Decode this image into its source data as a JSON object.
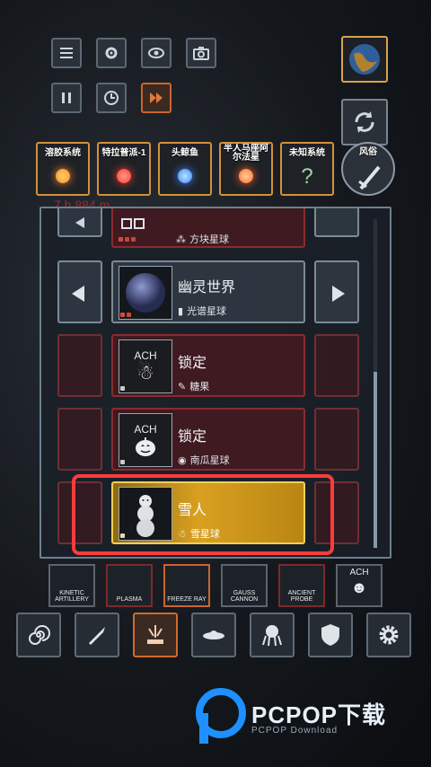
{
  "toolbar": {
    "menu_icon": "menu-icon",
    "settings_icon": "gear-icon",
    "view_icon": "eye-icon",
    "camera_icon": "camera-icon",
    "pause_icon": "pause-icon",
    "time_icon": "clock-icon",
    "fastforward_icon": "fast-forward-icon"
  },
  "background_stat": "7.h 884 m",
  "categories": [
    {
      "label": "溶胶系统",
      "color": "#ff8a2a"
    },
    {
      "label": "特拉普派-1",
      "color": "#ff4a3a"
    },
    {
      "label": "头鲸鱼",
      "color": "#3a8bff"
    },
    {
      "label": "半人马座阿尔法星",
      "color": "#ff6a2a"
    },
    {
      "label": "未知系统",
      "color": "#7ad07a"
    },
    {
      "label": "风俗",
      "color": "#cfd6dc"
    }
  ],
  "list": {
    "rows": [
      {
        "title": "",
        "subtitle": "方块星球",
        "state": "red"
      },
      {
        "title": "幽灵世界",
        "subtitle": "光谱星球",
        "state": "grey"
      },
      {
        "title": "锁定",
        "subtitle": "糖果",
        "state": "red",
        "badge": "ACH"
      },
      {
        "title": "锁定",
        "subtitle": "南瓜星球",
        "state": "red",
        "badge": "ACH"
      },
      {
        "title": "雪人",
        "subtitle": "雪星球",
        "state": "gold"
      }
    ]
  },
  "weapons": [
    {
      "label": "KINETIC ARTILLERY"
    },
    {
      "label": "PLASMA"
    },
    {
      "label": "FREEZE RAY"
    },
    {
      "label": "GAUSS CANNON"
    },
    {
      "label": "ANCIENT PROBE"
    },
    {
      "label": "ACH"
    }
  ],
  "watermark": {
    "main": "PCPOP下载",
    "sub": "PCPOP Download"
  },
  "colors": {
    "highlight": "#ff3b3b",
    "selected": "#f1cf5a",
    "accent": "#d06a2c"
  }
}
